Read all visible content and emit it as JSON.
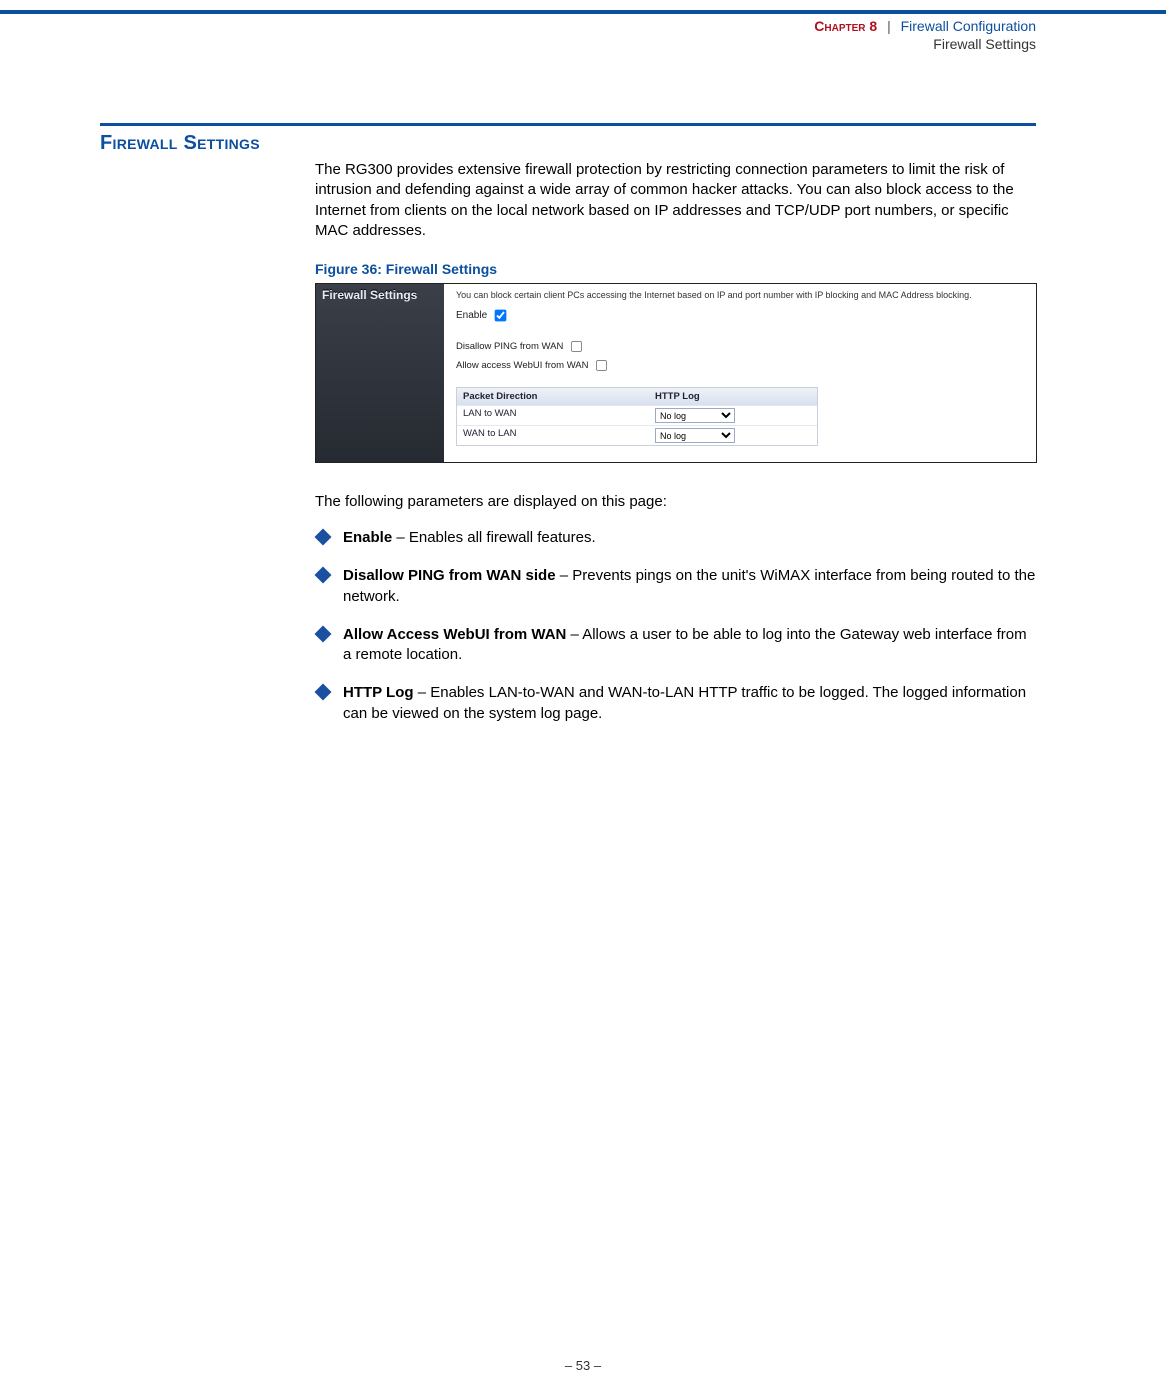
{
  "header": {
    "chapter_label": "Chapter 8",
    "separator": "|",
    "chapter_title": "Firewall Configuration",
    "subtitle": "Firewall Settings"
  },
  "section": {
    "heading": "Firewall Settings",
    "intro": "The RG300 provides extensive firewall protection by restricting connection parameters to limit the risk of intrusion and defending against a wide array of common hacker attacks. You can also block access to the Internet from clients on the local network based on IP addresses and TCP/UDP port numbers, or specific MAC addresses."
  },
  "figure": {
    "caption": "Figure 36:  Firewall Settings",
    "sidebar_label": "Firewall Settings",
    "description": "You can block certain client PCs accessing the Internet based on IP and port number with IP blocking and MAC Address blocking.",
    "enable_label": "Enable",
    "enable_checked": true,
    "opt1": "Disallow PING from WAN",
    "opt1_checked": false,
    "opt2": "Allow access WebUI from WAN",
    "opt2_checked": false,
    "table": {
      "col1": "Packet Direction",
      "col2": "HTTP Log",
      "rows": [
        {
          "dir": "LAN to WAN",
          "val": "No log"
        },
        {
          "dir": "WAN to LAN",
          "val": "No log"
        }
      ]
    }
  },
  "params": {
    "intro": "The following parameters are displayed on this page:",
    "items": [
      {
        "label": "Enable",
        "desc": " – Enables all firewall features."
      },
      {
        "label": "Disallow PING from WAN side",
        "desc": " – Prevents pings on the unit's WiMAX interface from being routed to the network."
      },
      {
        "label": "Allow Access WebUI from WAN",
        "desc": " – Allows a user to be able to log into the Gateway web interface from a remote location."
      },
      {
        "label": "HTTP Log",
        "desc": " – Enables LAN-to-WAN and WAN-to-LAN HTTP traffic to be logged. The logged information can be viewed on the system log page."
      }
    ]
  },
  "footer": {
    "page": "–  53  –"
  }
}
